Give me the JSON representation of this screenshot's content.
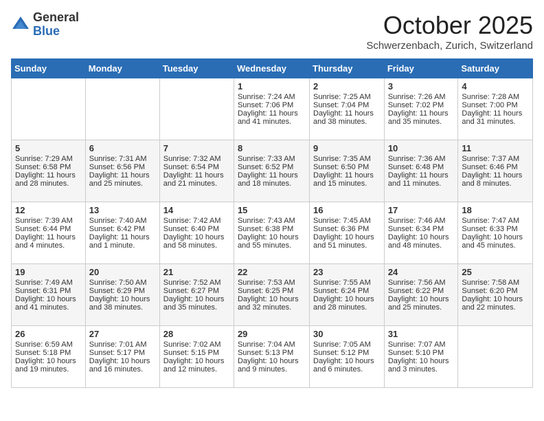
{
  "logo": {
    "general": "General",
    "blue": "Blue"
  },
  "title": "October 2025",
  "location": "Schwerzenbach, Zurich, Switzerland",
  "days_of_week": [
    "Sunday",
    "Monday",
    "Tuesday",
    "Wednesday",
    "Thursday",
    "Friday",
    "Saturday"
  ],
  "weeks": [
    [
      {
        "day": "",
        "info": ""
      },
      {
        "day": "",
        "info": ""
      },
      {
        "day": "",
        "info": ""
      },
      {
        "day": "1",
        "info": "Sunrise: 7:24 AM\nSunset: 7:06 PM\nDaylight: 11 hours\nand 41 minutes."
      },
      {
        "day": "2",
        "info": "Sunrise: 7:25 AM\nSunset: 7:04 PM\nDaylight: 11 hours\nand 38 minutes."
      },
      {
        "day": "3",
        "info": "Sunrise: 7:26 AM\nSunset: 7:02 PM\nDaylight: 11 hours\nand 35 minutes."
      },
      {
        "day": "4",
        "info": "Sunrise: 7:28 AM\nSunset: 7:00 PM\nDaylight: 11 hours\nand 31 minutes."
      }
    ],
    [
      {
        "day": "5",
        "info": "Sunrise: 7:29 AM\nSunset: 6:58 PM\nDaylight: 11 hours\nand 28 minutes."
      },
      {
        "day": "6",
        "info": "Sunrise: 7:31 AM\nSunset: 6:56 PM\nDaylight: 11 hours\nand 25 minutes."
      },
      {
        "day": "7",
        "info": "Sunrise: 7:32 AM\nSunset: 6:54 PM\nDaylight: 11 hours\nand 21 minutes."
      },
      {
        "day": "8",
        "info": "Sunrise: 7:33 AM\nSunset: 6:52 PM\nDaylight: 11 hours\nand 18 minutes."
      },
      {
        "day": "9",
        "info": "Sunrise: 7:35 AM\nSunset: 6:50 PM\nDaylight: 11 hours\nand 15 minutes."
      },
      {
        "day": "10",
        "info": "Sunrise: 7:36 AM\nSunset: 6:48 PM\nDaylight: 11 hours\nand 11 minutes."
      },
      {
        "day": "11",
        "info": "Sunrise: 7:37 AM\nSunset: 6:46 PM\nDaylight: 11 hours\nand 8 minutes."
      }
    ],
    [
      {
        "day": "12",
        "info": "Sunrise: 7:39 AM\nSunset: 6:44 PM\nDaylight: 11 hours\nand 4 minutes."
      },
      {
        "day": "13",
        "info": "Sunrise: 7:40 AM\nSunset: 6:42 PM\nDaylight: 11 hours\nand 1 minute."
      },
      {
        "day": "14",
        "info": "Sunrise: 7:42 AM\nSunset: 6:40 PM\nDaylight: 10 hours\nand 58 minutes."
      },
      {
        "day": "15",
        "info": "Sunrise: 7:43 AM\nSunset: 6:38 PM\nDaylight: 10 hours\nand 55 minutes."
      },
      {
        "day": "16",
        "info": "Sunrise: 7:45 AM\nSunset: 6:36 PM\nDaylight: 10 hours\nand 51 minutes."
      },
      {
        "day": "17",
        "info": "Sunrise: 7:46 AM\nSunset: 6:34 PM\nDaylight: 10 hours\nand 48 minutes."
      },
      {
        "day": "18",
        "info": "Sunrise: 7:47 AM\nSunset: 6:33 PM\nDaylight: 10 hours\nand 45 minutes."
      }
    ],
    [
      {
        "day": "19",
        "info": "Sunrise: 7:49 AM\nSunset: 6:31 PM\nDaylight: 10 hours\nand 41 minutes."
      },
      {
        "day": "20",
        "info": "Sunrise: 7:50 AM\nSunset: 6:29 PM\nDaylight: 10 hours\nand 38 minutes."
      },
      {
        "day": "21",
        "info": "Sunrise: 7:52 AM\nSunset: 6:27 PM\nDaylight: 10 hours\nand 35 minutes."
      },
      {
        "day": "22",
        "info": "Sunrise: 7:53 AM\nSunset: 6:25 PM\nDaylight: 10 hours\nand 32 minutes."
      },
      {
        "day": "23",
        "info": "Sunrise: 7:55 AM\nSunset: 6:24 PM\nDaylight: 10 hours\nand 28 minutes."
      },
      {
        "day": "24",
        "info": "Sunrise: 7:56 AM\nSunset: 6:22 PM\nDaylight: 10 hours\nand 25 minutes."
      },
      {
        "day": "25",
        "info": "Sunrise: 7:58 AM\nSunset: 6:20 PM\nDaylight: 10 hours\nand 22 minutes."
      }
    ],
    [
      {
        "day": "26",
        "info": "Sunrise: 6:59 AM\nSunset: 5:18 PM\nDaylight: 10 hours\nand 19 minutes."
      },
      {
        "day": "27",
        "info": "Sunrise: 7:01 AM\nSunset: 5:17 PM\nDaylight: 10 hours\nand 16 minutes."
      },
      {
        "day": "28",
        "info": "Sunrise: 7:02 AM\nSunset: 5:15 PM\nDaylight: 10 hours\nand 12 minutes."
      },
      {
        "day": "29",
        "info": "Sunrise: 7:04 AM\nSunset: 5:13 PM\nDaylight: 10 hours\nand 9 minutes."
      },
      {
        "day": "30",
        "info": "Sunrise: 7:05 AM\nSunset: 5:12 PM\nDaylight: 10 hours\nand 6 minutes."
      },
      {
        "day": "31",
        "info": "Sunrise: 7:07 AM\nSunset: 5:10 PM\nDaylight: 10 hours\nand 3 minutes."
      },
      {
        "day": "",
        "info": ""
      }
    ]
  ]
}
